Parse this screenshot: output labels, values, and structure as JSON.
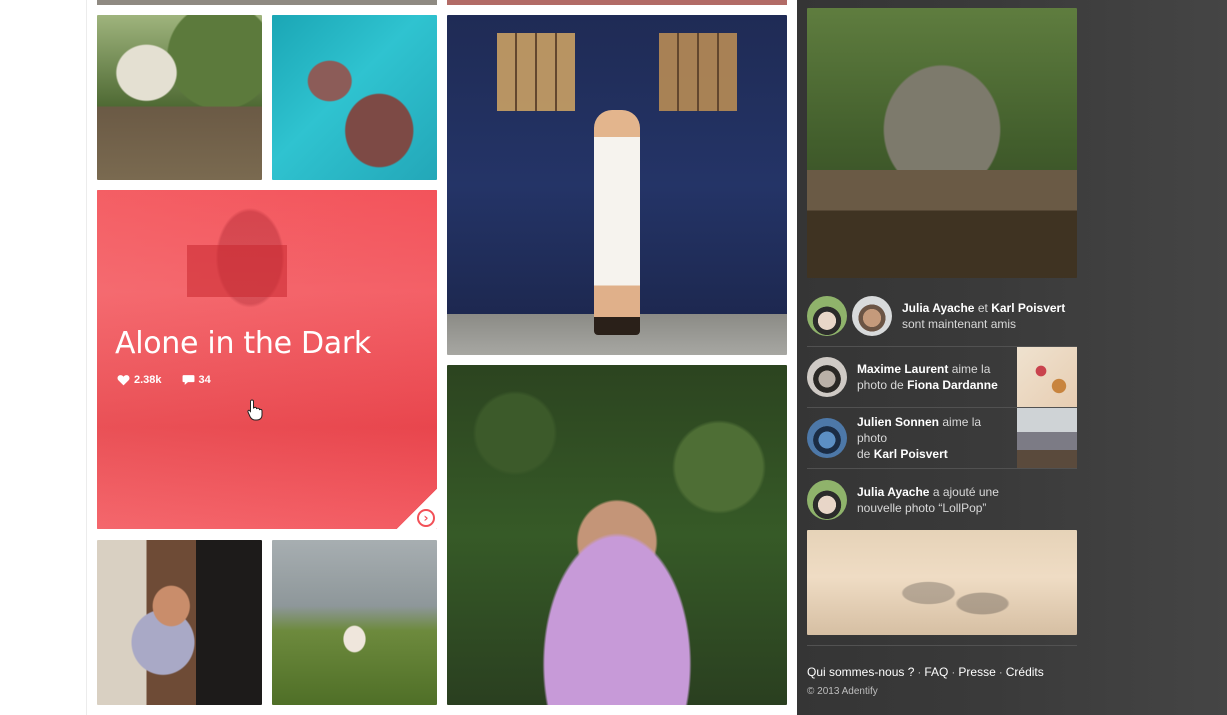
{
  "feature": {
    "title": "Alone in the Dark",
    "likes": "2.38k",
    "comments": "34",
    "icons": {
      "like": "heart-icon",
      "comment": "speech-bubble-icon",
      "next": "chevron-right-circle-icon"
    }
  },
  "feed": [
    {
      "actor": "Julia Ayache",
      "joiner": "et",
      "target": "Karl Poisvert",
      "text": "sont maintenant amis"
    },
    {
      "actor": "Maxime Laurent",
      "text1": "aime la",
      "text2": "photo de",
      "target": "Fiona Dardanne"
    },
    {
      "actor": "Julien Sonnen",
      "text1": "aime la photo",
      "text2": "de",
      "target": "Karl Poisvert"
    },
    {
      "actor": "Julia Ayache",
      "text1": "a ajouté une",
      "text2": "nouvelle photo “LollPop”"
    }
  ],
  "footer": {
    "links": [
      "Qui sommes-nous ?",
      "FAQ",
      "Presse",
      "Crédits"
    ],
    "separator": "·",
    "copyright": "© 2013 Adentify"
  },
  "colors": {
    "accent": "#f25057",
    "sidebar": "#3a3a3a"
  }
}
